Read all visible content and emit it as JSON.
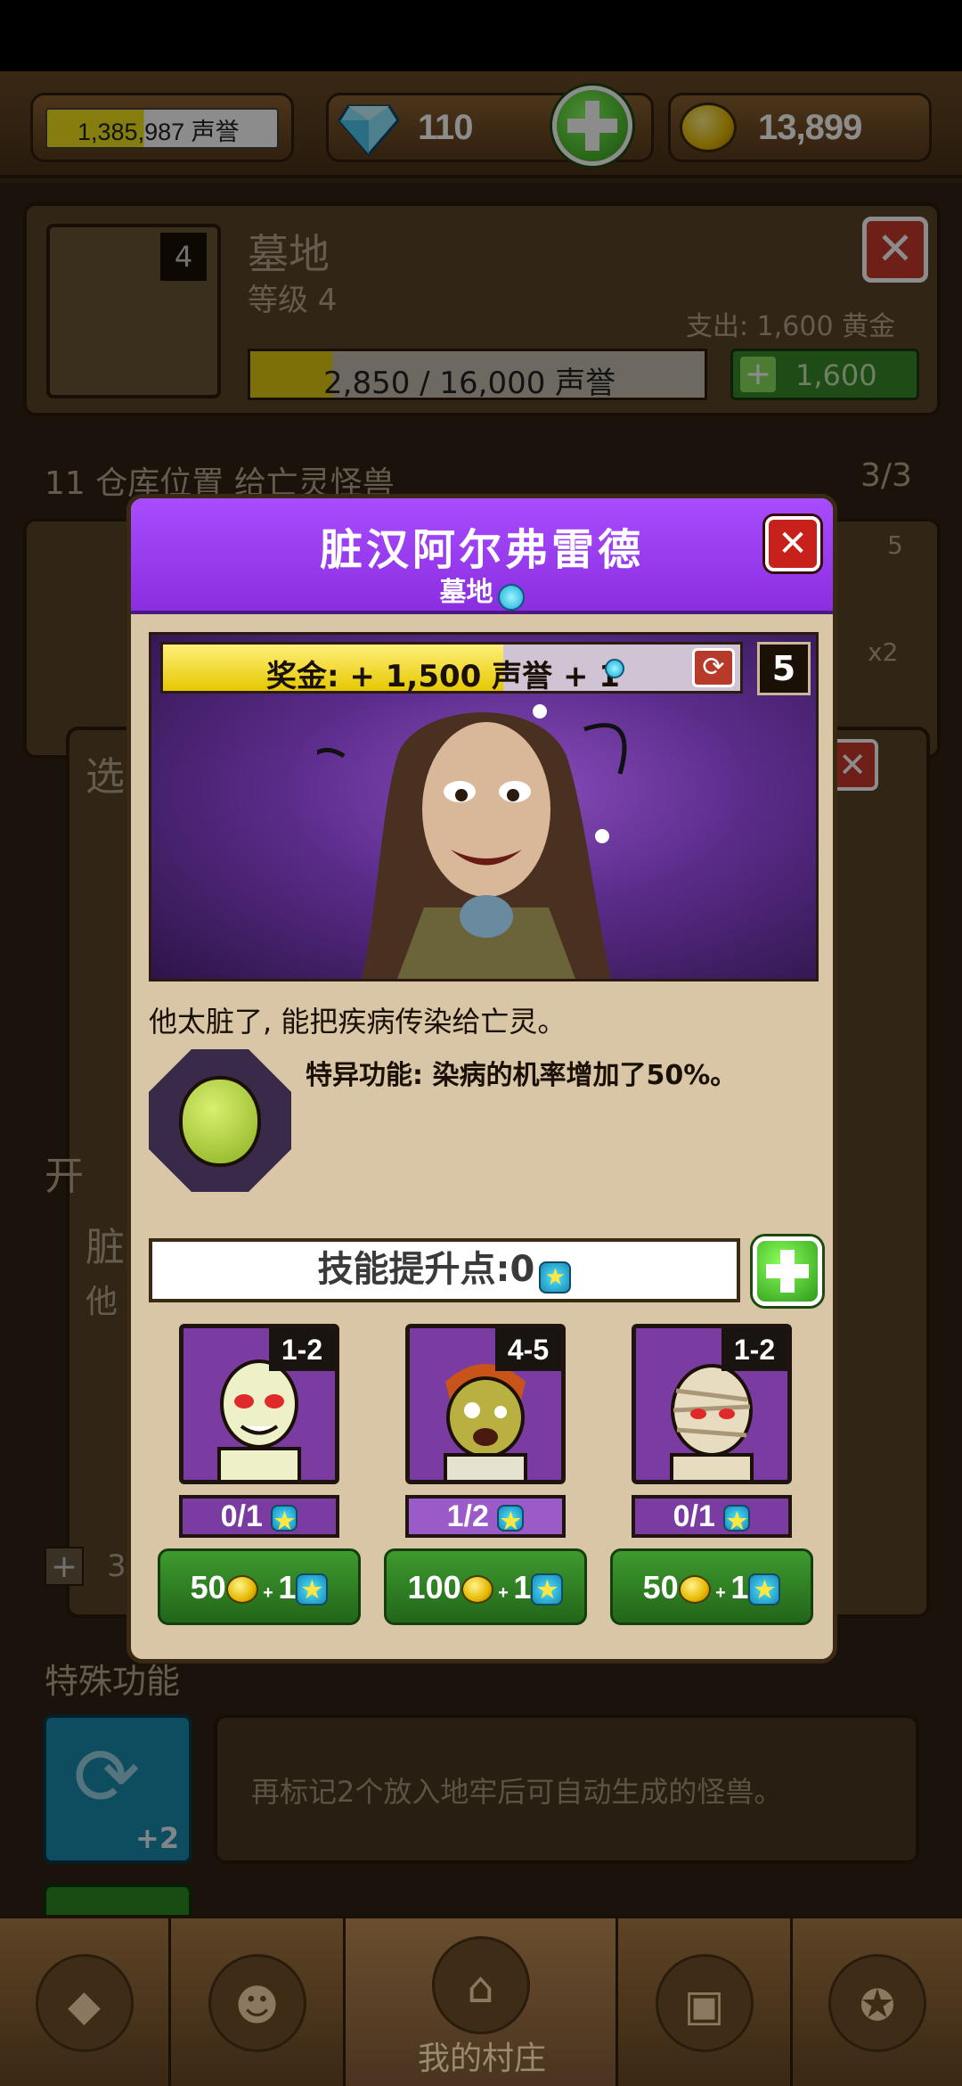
{
  "topbar": {
    "reputation": "1,385,987 声誉",
    "gems": "110",
    "gold": "13,899"
  },
  "background": {
    "building_name": "墓地",
    "building_level": "等级 4",
    "building_badge": "4",
    "expense": "支出: 1,600 黄金",
    "rep_progress": "2,850 / 16,000 声誉",
    "rep_progress_fraction": 0.18,
    "upgrade_cost": "1,600",
    "storage_text": "11 仓库位置 给亡灵怪兽",
    "storage_count": "3/3",
    "side_badge": "5",
    "side_count": "x2",
    "side_letter_1": "选",
    "side_letter_2": "开",
    "side_letter_3": "脏",
    "side_letter_4": "他",
    "special_title": "特殊功能",
    "special_desc": "再标记2个放入地牢后可自动生成的怪兽。",
    "special_bonus": "+2",
    "small_count": "3"
  },
  "modal": {
    "title": "脏汉阿尔弗雷德",
    "subtitle": "墓地",
    "bonus_text": "奖金: + 1,500 声誉 + 1",
    "bonus_fraction": 0.59,
    "level": "5",
    "description": "他太脏了, 能把疾病传染给亡灵。",
    "ability": "特异功能: 染病的机率增加了50%。",
    "skill_points": "技能提升点:0",
    "skills": [
      {
        "name": "skeleton",
        "range": "1-2",
        "progress": "0/1",
        "cost_gold": "50",
        "cost_points": "1"
      },
      {
        "name": "zombie",
        "range": "4-5",
        "progress": "1/2",
        "cost_gold": "100",
        "cost_points": "1"
      },
      {
        "name": "mummy",
        "range": "1-2",
        "progress": "0/1",
        "cost_gold": "50",
        "cost_points": "1"
      }
    ]
  },
  "navbar": {
    "active_label": "我的村庄"
  },
  "colors": {
    "modal_header": "#9a3cf0",
    "bar_yellow": "#f2d21a",
    "green_button": "#2e8a22"
  }
}
